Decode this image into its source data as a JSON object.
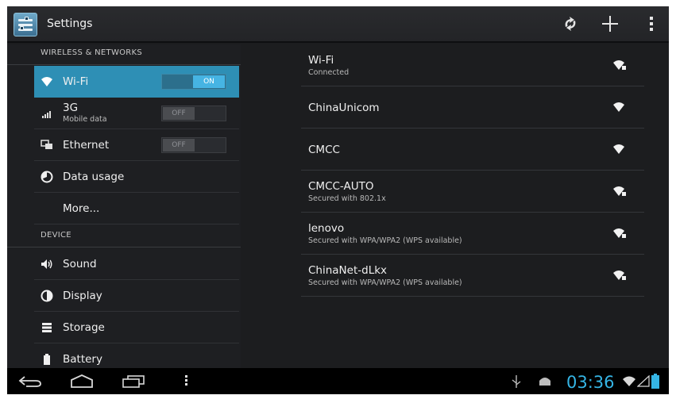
{
  "actionbar": {
    "title": "Settings",
    "icons": [
      "settings-app-icon",
      "sync-icon",
      "add-icon",
      "overflow-menu-icon"
    ]
  },
  "left_panel": {
    "wireless_header": "WIRELESS & NETWORKS",
    "device_header": "DEVICE",
    "items": [
      {
        "label": "Wi-Fi",
        "icon": "wifi-icon",
        "toggle": "ON",
        "selected": true
      },
      {
        "label": "3G",
        "sub": "Mobile data",
        "icon": "signal-icon",
        "toggle": "OFF"
      },
      {
        "label": "Ethernet",
        "icon": "ethernet-icon",
        "toggle": "OFF"
      },
      {
        "label": "Data usage",
        "icon": "data-usage-icon"
      },
      {
        "label": "More..."
      },
      {
        "label": "Sound",
        "icon": "sound-icon"
      },
      {
        "label": "Display",
        "icon": "display-icon"
      },
      {
        "label": "Storage",
        "icon": "storage-icon"
      },
      {
        "label": "Battery",
        "icon": "battery-icon"
      }
    ]
  },
  "networks": [
    {
      "name": "Wi-Fi",
      "status": "Connected",
      "secured": true
    },
    {
      "name": "ChinaUnicom",
      "status": "",
      "secured": false
    },
    {
      "name": "CMCC",
      "status": "",
      "secured": false
    },
    {
      "name": "CMCC-AUTO",
      "status": "Secured with 802.1x",
      "secured": true
    },
    {
      "name": "lenovo",
      "status": "Secured with WPA/WPA2 (WPS available)",
      "secured": true
    },
    {
      "name": "ChinaNet-dLkx",
      "status": "Secured with WPA/WPA2 (WPS available)",
      "secured": true
    }
  ],
  "system_bar": {
    "time": "03:36",
    "icons": [
      "back-icon",
      "home-icon",
      "recent-apps-icon",
      "menu-icon",
      "usb-icon",
      "android-icon",
      "wifi-status-icon",
      "signal-status-icon",
      "battery-status-icon"
    ]
  },
  "colors": {
    "accent": "#35b5e5",
    "selected_row": "#2e8fb5",
    "background": "#1c1d1f"
  }
}
